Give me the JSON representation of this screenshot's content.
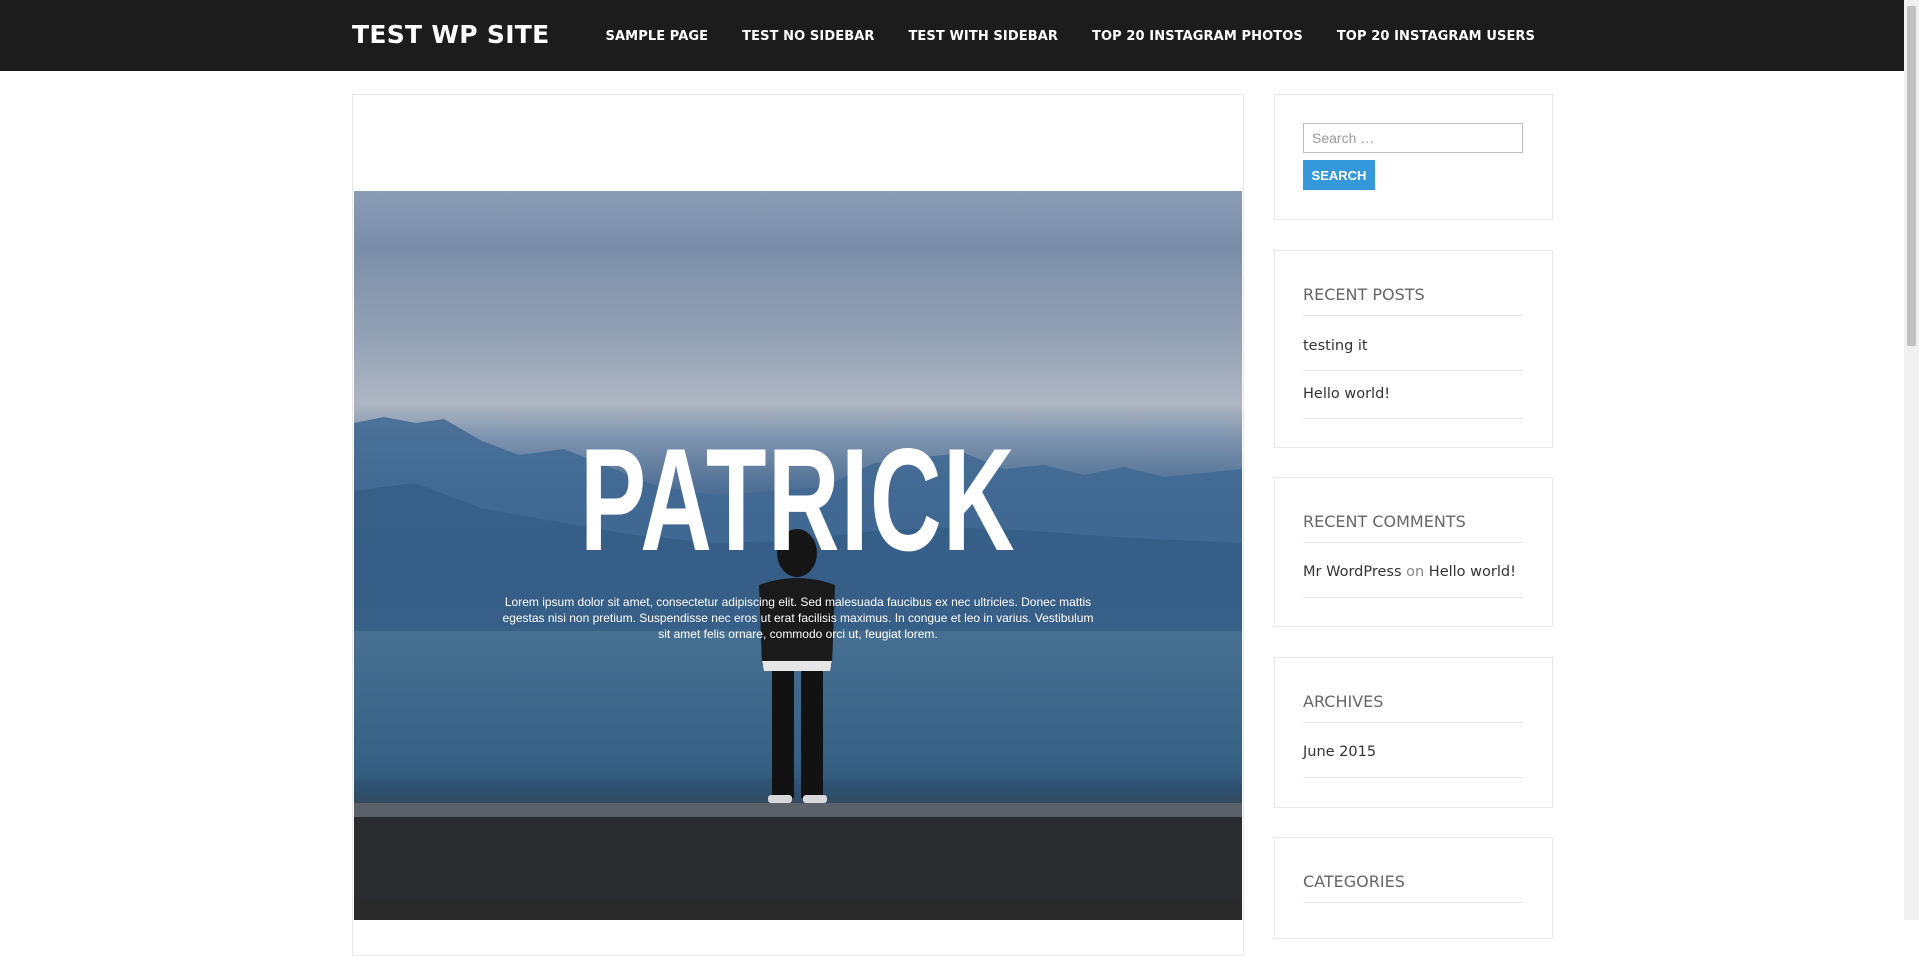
{
  "site": {
    "title": "TEST WP SITE",
    "nav": [
      "SAMPLE PAGE",
      "TEST NO SIDEBAR",
      "TEST WITH SIDEBAR",
      "TOP 20 INSTAGRAM PHOTOS",
      "TOP 20 INSTAGRAM USERS"
    ]
  },
  "hero": {
    "title": "PATRICK",
    "text": "Lorem ipsum dolor sit amet, consectetur adipiscing elit. Sed malesuada faucibus ex nec ultricies. Donec mattis egestas nisi non pretium. Suspendisse nec eros ut erat facilisis maximus. In congue et leo in varius. Vestibulum sit amet felis ornare, commodo orci ut, feugiat lorem."
  },
  "sidebar": {
    "search": {
      "placeholder": "Search …",
      "button": "SEARCH"
    },
    "recent_posts": {
      "title": "RECENT POSTS",
      "items": [
        "testing it",
        "Hello world!"
      ]
    },
    "recent_comments": {
      "title": "RECENT COMMENTS",
      "author": "Mr WordPress",
      "on": "on",
      "post": "Hello world!"
    },
    "archives": {
      "title": "ARCHIVES",
      "items": [
        "June 2015"
      ]
    },
    "categories": {
      "title": "CATEGORIES"
    }
  },
  "colors": {
    "topbar": "#1c1c1c",
    "accent": "#3498db"
  }
}
